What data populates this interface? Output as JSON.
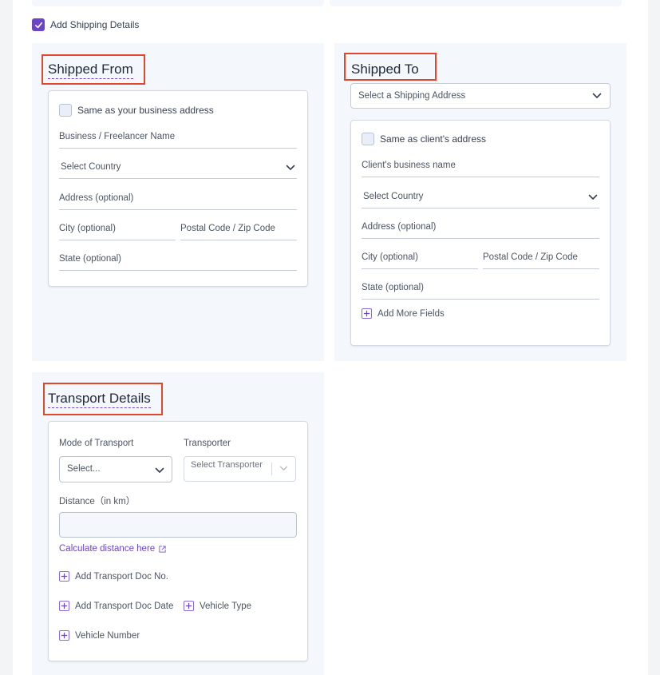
{
  "shipping_toggle": {
    "label": "Add Shipping Details",
    "checked": true
  },
  "shipped_from": {
    "title": "Shipped From",
    "same_as_label": "Same as your business address",
    "name_placeholder": "Business / Freelancer Name",
    "country_placeholder": "Select Country",
    "address_placeholder": "Address (optional)",
    "city_placeholder": "City (optional)",
    "postal_placeholder": "Postal Code / Zip Code",
    "state_placeholder": "State (optional)"
  },
  "shipped_to": {
    "title": "Shipped To",
    "address_select_placeholder": "Select a Shipping Address",
    "same_as_label": "Same as client's address",
    "name_placeholder": "Client's business name",
    "country_placeholder": "Select Country",
    "address_placeholder": "Address (optional)",
    "city_placeholder": "City (optional)",
    "postal_placeholder": "Postal Code / Zip Code",
    "state_placeholder": "State (optional)",
    "add_more_label": "Add More Fields"
  },
  "transport": {
    "title": "Transport Details",
    "mode_label": "Mode of Transport",
    "mode_placeholder": "Select...",
    "transporter_label": "Transporter",
    "transporter_placeholder": "Select Transporter",
    "distance_label": "Distance（in km）",
    "distance_value": "",
    "calc_link": "Calculate distance here",
    "add_doc_no": "Add Transport Doc No.",
    "add_doc_date": "Add Transport Doc Date",
    "add_vehicle_type": "Vehicle Type",
    "add_vehicle_number": "Vehicle Number"
  },
  "colors": {
    "accent": "#6d44c6",
    "highlight_border": "#e0472b",
    "section_bg": "#f4f7fc"
  },
  "icons": {
    "check": "check-icon",
    "chevron": "chevron-down-icon",
    "plus": "plus-square-icon",
    "external": "external-link-icon"
  }
}
